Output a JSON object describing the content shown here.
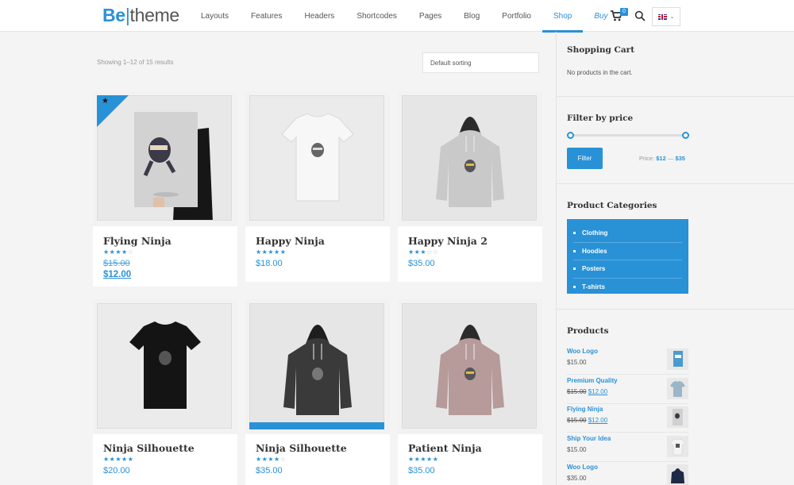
{
  "header": {
    "logo_be": "Be",
    "logo_sep": "|",
    "logo_theme": "theme",
    "nav": [
      "Layouts",
      "Features",
      "Headers",
      "Shortcodes",
      "Pages",
      "Blog",
      "Portfolio",
      "Shop",
      "Buy"
    ],
    "active_nav": "Shop",
    "cart_count": "0",
    "language_flag": "uk-flag"
  },
  "shop": {
    "result_count": "Showing 1–12 of 15 results",
    "sort_value": "Default sorting",
    "products": [
      {
        "name": "Flying Ninja",
        "rating": 4,
        "old_price": "$15.00",
        "price": "$12.00",
        "on_sale": true
      },
      {
        "name": "Happy Ninja",
        "rating": 5,
        "price": "$18.00"
      },
      {
        "name": "Happy Ninja 2",
        "rating": 3,
        "price": "$35.00"
      },
      {
        "name": "Ninja Silhouette",
        "rating": 5,
        "price": "$20.00"
      },
      {
        "name": "Ninja Silhouette",
        "rating": 4,
        "price": "$35.00"
      },
      {
        "name": "Patient Ninja",
        "rating": 5,
        "price": "$35.00"
      }
    ]
  },
  "sidebar": {
    "cart": {
      "title": "Shopping Cart",
      "empty": "No products in the cart."
    },
    "filter": {
      "title": "Filter by price",
      "button": "Filter",
      "label": "Price:",
      "min": "$12",
      "dash": "—",
      "max": "$35"
    },
    "categories": {
      "title": "Product Categories",
      "items": [
        "Clothing",
        "Hoodies",
        "Posters",
        "T-shirts"
      ]
    },
    "products": {
      "title": "Products",
      "items": [
        {
          "name": "Woo Logo",
          "price": "$15.00"
        },
        {
          "name": "Premium Quality",
          "old_price": "$15.00",
          "price": "$12.00"
        },
        {
          "name": "Flying Ninja",
          "old_price": "$15.00",
          "price": "$12.00"
        },
        {
          "name": "Ship Your Idea",
          "price": "$15.00"
        },
        {
          "name": "Woo Logo",
          "price": "$35.00"
        }
      ]
    }
  },
  "colors": {
    "accent": "#2991d6",
    "background": "#f4f4f4"
  }
}
